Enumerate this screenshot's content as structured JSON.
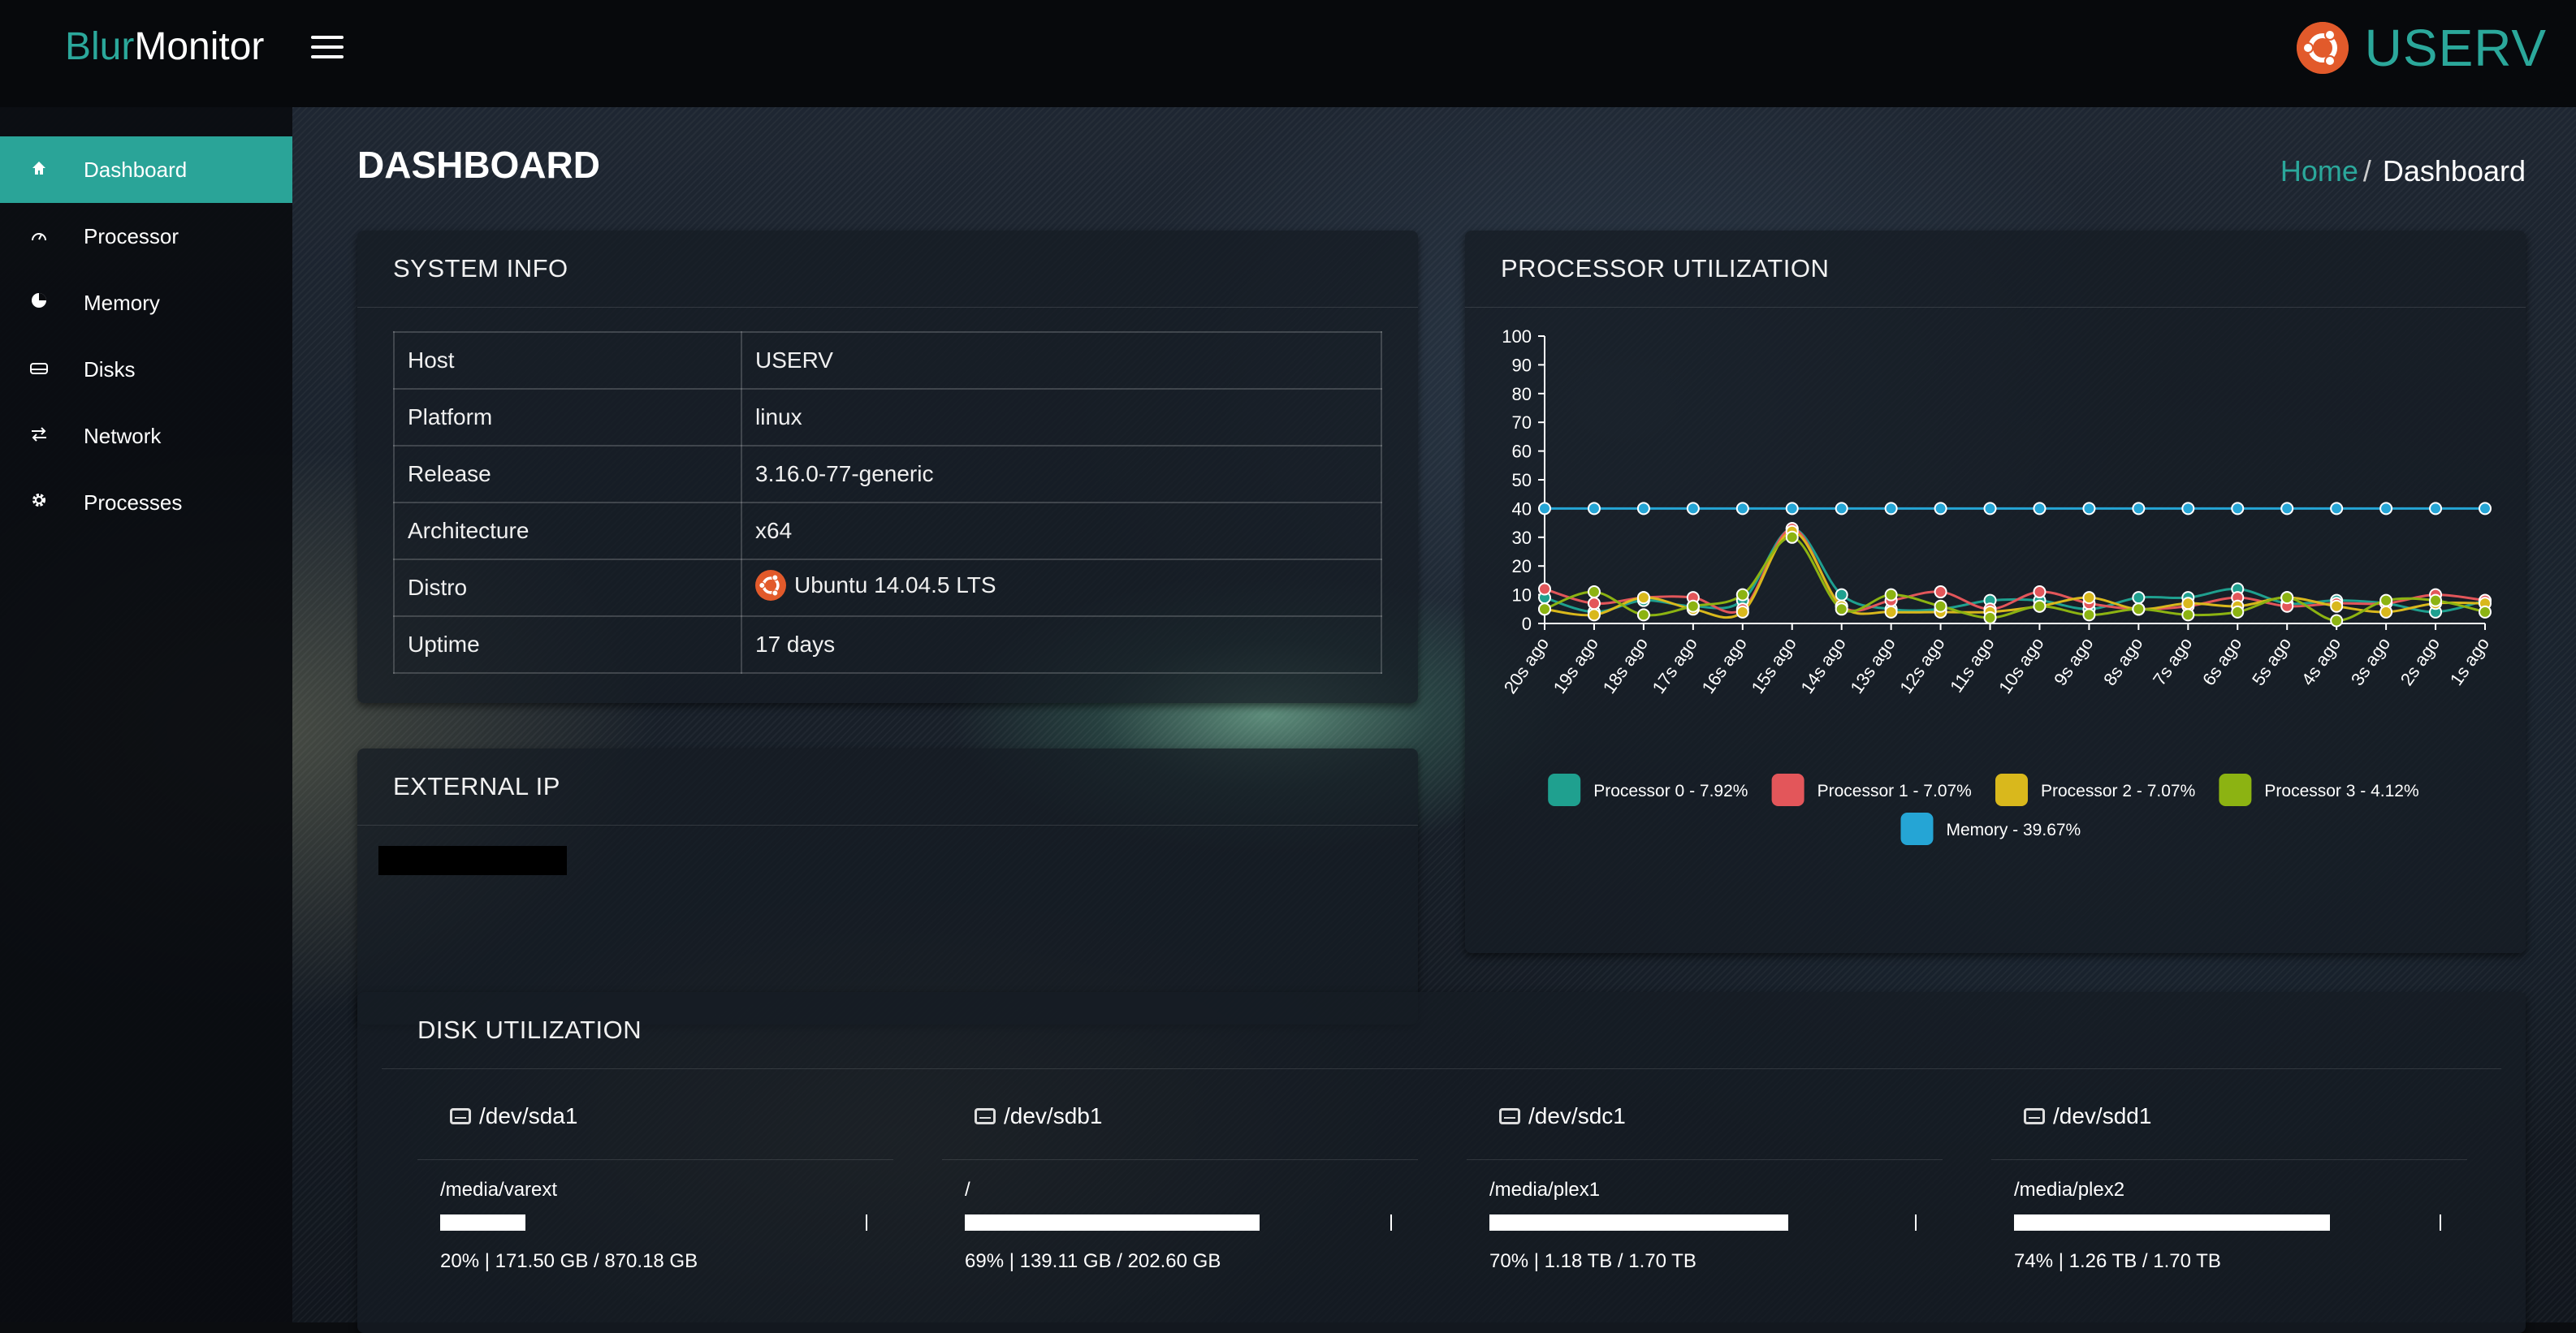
{
  "app": {
    "brand_blur": "Blur",
    "brand_monitor": "Monitor",
    "host_name": "USERV"
  },
  "sidebar": {
    "items": [
      {
        "label": "Dashboard",
        "icon": "home-icon",
        "active": true
      },
      {
        "label": "Processor",
        "icon": "gauge-icon",
        "active": false
      },
      {
        "label": "Memory",
        "icon": "pie-icon",
        "active": false
      },
      {
        "label": "Disks",
        "icon": "disk-icon",
        "active": false
      },
      {
        "label": "Network",
        "icon": "transfer-icon",
        "active": false
      },
      {
        "label": "Processes",
        "icon": "gear-icon",
        "active": false
      }
    ]
  },
  "page": {
    "title": "DASHBOARD"
  },
  "breadcrumb": {
    "home": "Home",
    "separator": "/",
    "current": "Dashboard"
  },
  "system_info": {
    "title": "SYSTEM INFO",
    "rows": [
      {
        "key": "Host",
        "value": "USERV"
      },
      {
        "key": "Platform",
        "value": "linux"
      },
      {
        "key": "Release",
        "value": "3.16.0-77-generic"
      },
      {
        "key": "Architecture",
        "value": "x64"
      },
      {
        "key": "Distro",
        "value": "Ubuntu 14.04.5 LTS"
      },
      {
        "key": "Uptime",
        "value": "17 days"
      }
    ]
  },
  "external_ip": {
    "title": "EXTERNAL IP",
    "value": ""
  },
  "processor_panel": {
    "title": "PROCESSOR UTILIZATION"
  },
  "chart_data": {
    "type": "line",
    "title": "",
    "xlabel": "",
    "ylabel": "",
    "ylim": [
      0,
      100
    ],
    "yticks": [
      0,
      10,
      20,
      30,
      40,
      50,
      60,
      70,
      80,
      90,
      100
    ],
    "categories": [
      "20s ago",
      "19s ago",
      "18s ago",
      "17s ago",
      "16s ago",
      "15s ago",
      "14s ago",
      "13s ago",
      "12s ago",
      "11s ago",
      "10s ago",
      "9s ago",
      "8s ago",
      "7s ago",
      "6s ago",
      "5s ago",
      "4s ago",
      "3s ago",
      "2s ago",
      "1s ago"
    ],
    "legend_position": "bottom",
    "series": [
      {
        "name": "Processor 0 - 7.92%",
        "color": "#1fa08f",
        "values": [
          9,
          4,
          8,
          6,
          8,
          33,
          10,
          5,
          5,
          8,
          8,
          5,
          9,
          9,
          12,
          7,
          8,
          7,
          4,
          8
        ]
      },
      {
        "name": "Processor 1 - 7.07%",
        "color": "#e3565a",
        "values": [
          12,
          7,
          9,
          9,
          5,
          33,
          6,
          8,
          11,
          5,
          11,
          7,
          5,
          6,
          9,
          6,
          7,
          7,
          10,
          8
        ]
      },
      {
        "name": "Processor 2 - 7.07%",
        "color": "#d9b81c",
        "values": [
          5,
          3,
          9,
          5,
          4,
          32,
          6,
          4,
          4,
          4,
          6,
          9,
          5,
          7,
          6,
          9,
          6,
          4,
          7,
          7
        ]
      },
      {
        "name": "Processor 3 - 4.12%",
        "color": "#8cb312",
        "values": [
          5,
          11,
          3,
          6,
          10,
          30,
          5,
          10,
          6,
          2,
          6,
          3,
          5,
          3,
          4,
          9,
          1,
          8,
          8,
          4
        ]
      },
      {
        "name": "Memory - 39.67%",
        "color": "#25a5d5",
        "values": [
          40,
          40,
          40,
          40,
          40,
          40,
          40,
          40,
          40,
          40,
          40,
          40,
          40,
          40,
          40,
          40,
          40,
          40,
          40,
          40
        ]
      }
    ]
  },
  "disk_panel": {
    "title": "DISK UTILIZATION",
    "disks": [
      {
        "device": "/dev/sda1",
        "mount": "/media/varext",
        "percent": 20,
        "stat": "20% | 171.50 GB / 870.18 GB"
      },
      {
        "device": "/dev/sdb1",
        "mount": "/",
        "percent": 69,
        "stat": "69% | 139.11 GB / 202.60 GB"
      },
      {
        "device": "/dev/sdc1",
        "mount": "/media/plex1",
        "percent": 70,
        "stat": "70% | 1.18 TB / 1.70 TB"
      },
      {
        "device": "/dev/sdd1",
        "mount": "/media/plex2",
        "percent": 74,
        "stat": "74% | 1.26 TB / 1.70 TB"
      }
    ]
  }
}
